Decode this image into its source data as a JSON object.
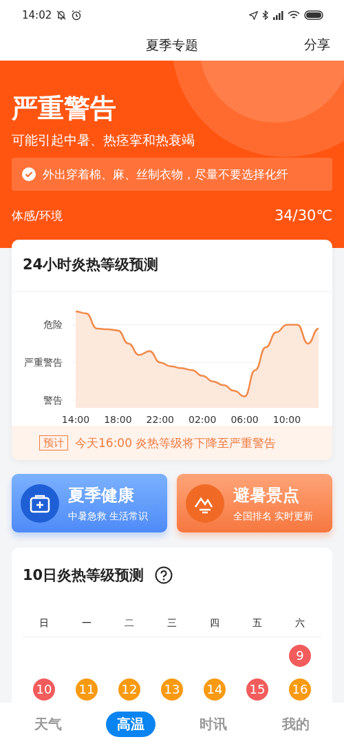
{
  "status_bar": {
    "time": "14:02"
  },
  "header": {
    "title": "夏季专题",
    "action": "分享"
  },
  "alert": {
    "level": "严重警告",
    "description": "可能引起中暑、热痉挛和热衰竭",
    "tip": "外出穿着棉、麻、丝制衣物，尽量不要选择化纤",
    "feel_label": "体感/环境",
    "feel_value": "34/30℃"
  },
  "forecast_24h": {
    "title": "24小时炎热等级预测",
    "y_labels": [
      "危险",
      "严重警告",
      "警告"
    ],
    "x_labels": [
      "14:00",
      "18:00",
      "22:00",
      "02:00",
      "06:00",
      "10:00"
    ],
    "note_tag": "预计",
    "note": "今天16:00 炎热等级将下降至严重警告"
  },
  "shortcuts": [
    {
      "kind": "health",
      "title": "夏季健康",
      "subtitle": "中暑急救 生活常识"
    },
    {
      "kind": "scenic",
      "title": "避暑景点",
      "subtitle": "全国排名 实时更新"
    }
  ],
  "calendar": {
    "title": "10日炎热等级预测",
    "weekdays": [
      "日",
      "一",
      "二",
      "三",
      "四",
      "五",
      "六"
    ],
    "weeks": [
      {
        "days": [
          {
            "day": "9",
            "color": "#f25c5c"
          }
        ]
      },
      {
        "days": [
          {
            "day": "10",
            "color": "#f25c5c"
          },
          {
            "day": "11",
            "color": "#f89a12"
          },
          {
            "day": "12",
            "color": "#f89a12"
          },
          {
            "day": "13",
            "color": "#f89a12"
          },
          {
            "day": "14",
            "color": "#f89a12"
          },
          {
            "day": "15",
            "color": "#f25c5c"
          },
          {
            "day": "16",
            "color": "#f89a12"
          }
        ]
      }
    ]
  },
  "nav": [
    {
      "label": "天气",
      "selected": false
    },
    {
      "label": "高温",
      "selected": true
    },
    {
      "label": "时讯",
      "selected": false
    },
    {
      "label": "我的",
      "selected": false
    }
  ]
}
